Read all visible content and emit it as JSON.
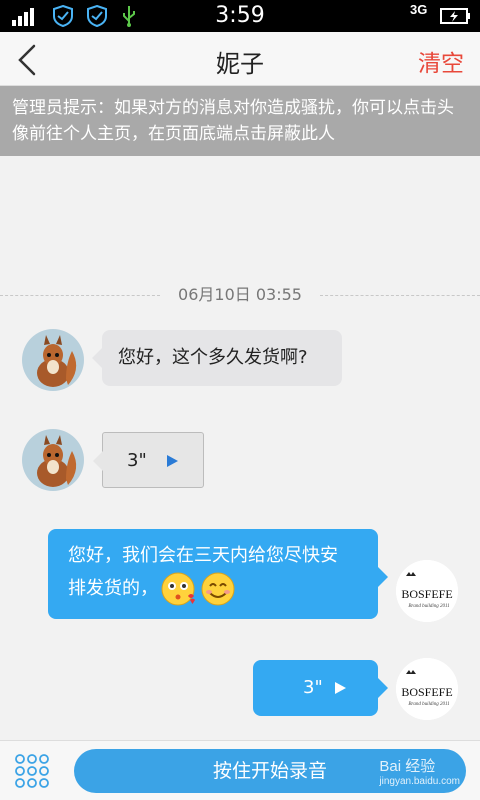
{
  "status_bar": {
    "time": "3:59",
    "network": "3G",
    "icons": [
      "signal-icon",
      "shield-icon",
      "shield-icon",
      "usb-icon",
      "network-3g-icon",
      "battery-icon"
    ]
  },
  "header": {
    "title": "妮子",
    "clear_label": "清空",
    "back_icon": "chevron-left-icon"
  },
  "notice": {
    "text": "管理员提示：如果对方的消息对你造成骚扰，你可以点击头像前往个人主页，在页面底端点击屏蔽此人"
  },
  "chat": {
    "date": "06月10日 03:55",
    "messages": [
      {
        "side": "in",
        "type": "text",
        "text": "您好，这个多久发货啊?"
      },
      {
        "side": "in",
        "type": "voice",
        "duration": "3\""
      },
      {
        "side": "out",
        "type": "text",
        "text_line1": "您好，我们会在三天内给您尽快安",
        "text_line2": "排发货的，",
        "emojis": [
          "kiss-emoji",
          "smile-emoji"
        ]
      },
      {
        "side": "out",
        "type": "voice",
        "duration": "3\""
      }
    ],
    "my_avatar_text": "BOSFEFE",
    "my_avatar_subtext": "Brand building 2011"
  },
  "footer": {
    "record_label": "按住开始录音",
    "menu_icon": "grid-dots-icon",
    "watermark": "Bai 经验",
    "watermark_sub": "jingyan.baidu.com"
  }
}
